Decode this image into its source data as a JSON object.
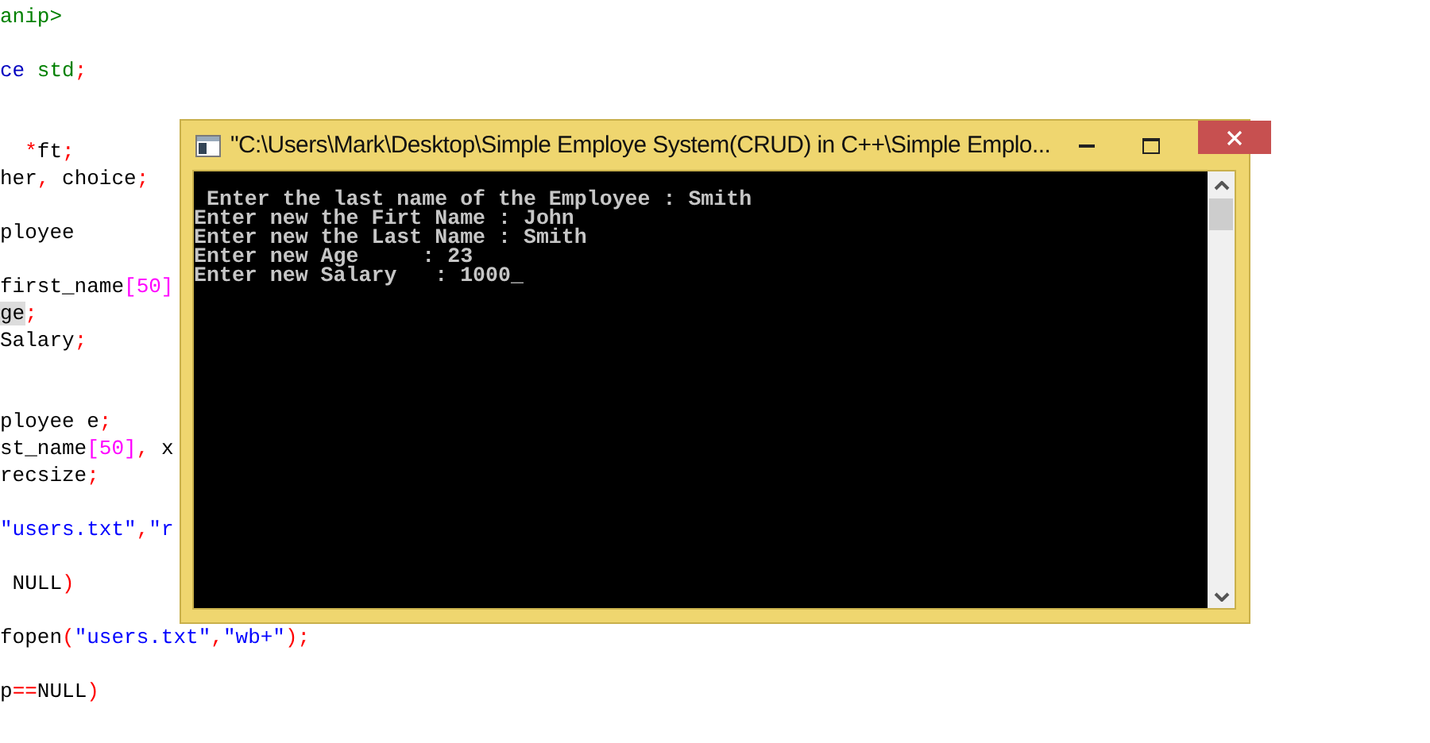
{
  "editor": {
    "lines": [
      {
        "tokens": [
          {
            "kind": "keyword",
            "text": "anip>"
          }
        ],
        "blank_after": true
      },
      {
        "tokens": [
          {
            "kind": "type",
            "text": "ce"
          },
          {
            "kind": "keyword",
            "text": " std"
          },
          {
            "kind": "op",
            "text": ";"
          }
        ],
        "blank_after": true
      },
      {
        "tokens": [
          {
            "kind": "op",
            "text": "  *"
          },
          {
            "kind": "plain",
            "text": "ft"
          },
          {
            "kind": "op",
            "text": ";"
          }
        ],
        "blank_before": true
      },
      {
        "tokens": [
          {
            "kind": "plain",
            "text": "her"
          },
          {
            "kind": "op",
            "text": ","
          },
          {
            "kind": "plain",
            "text": " choice"
          },
          {
            "kind": "op",
            "text": ";"
          }
        ],
        "blank_after": true
      },
      {
        "tokens": [
          {
            "kind": "plain",
            "text": "ployee"
          }
        ],
        "blank_after": true
      },
      {
        "tokens": [
          {
            "kind": "plain",
            "text": "first_name"
          },
          {
            "kind": "number",
            "text": "[50]"
          }
        ]
      },
      {
        "tokens": [
          {
            "kind": "plain",
            "text": "ge",
            "highlighted": true
          },
          {
            "kind": "op",
            "text": ";"
          }
        ]
      },
      {
        "tokens": [
          {
            "kind": "plain",
            "text": "Salary"
          },
          {
            "kind": "op",
            "text": ";"
          }
        ],
        "blank_after": true
      },
      {
        "tokens": [
          {
            "kind": "plain",
            "text": "ployee e"
          },
          {
            "kind": "op",
            "text": ";"
          }
        ],
        "blank_before": true
      },
      {
        "tokens": [
          {
            "kind": "plain",
            "text": "st_name"
          },
          {
            "kind": "number",
            "text": "[50]"
          },
          {
            "kind": "op",
            "text": ","
          },
          {
            "kind": "plain",
            "text": " x"
          }
        ]
      },
      {
        "tokens": [
          {
            "kind": "plain",
            "text": "recsize"
          },
          {
            "kind": "op",
            "text": ";"
          }
        ],
        "blank_after": true
      },
      {
        "tokens": [
          {
            "kind": "string",
            "text": "\"users.txt\""
          },
          {
            "kind": "op",
            "text": ","
          },
          {
            "kind": "string",
            "text": "\"r"
          }
        ],
        "blank_after": true
      },
      {
        "tokens": [
          {
            "kind": "plain",
            "text": " NULL"
          },
          {
            "kind": "op",
            "text": ")"
          }
        ],
        "blank_after": true
      },
      {
        "tokens": [
          {
            "kind": "plain",
            "text": "fopen"
          },
          {
            "kind": "op",
            "text": "("
          },
          {
            "kind": "string",
            "text": "\"users.txt\""
          },
          {
            "kind": "op",
            "text": ","
          },
          {
            "kind": "string",
            "text": "\"wb+\""
          },
          {
            "kind": "op",
            "text": ");"
          }
        ],
        "blank_after": true
      },
      {
        "tokens": [
          {
            "kind": "plain",
            "text": "p"
          },
          {
            "kind": "op",
            "text": "=="
          },
          {
            "kind": "plain",
            "text": "NULL"
          },
          {
            "kind": "op",
            "text": ")"
          }
        ]
      }
    ]
  },
  "console": {
    "title": "\"C:\\Users\\Mark\\Desktop\\Simple Employe System(CRUD) in C++\\Simple Emplo...",
    "lines": [
      " Enter the last name of the Employee : Smith",
      "Enter new the Firt Name : John",
      "Enter new the Last Name : Smith",
      "Enter new Age     : 23",
      "Enter new Salary   : 1000"
    ],
    "cursor": "_"
  }
}
